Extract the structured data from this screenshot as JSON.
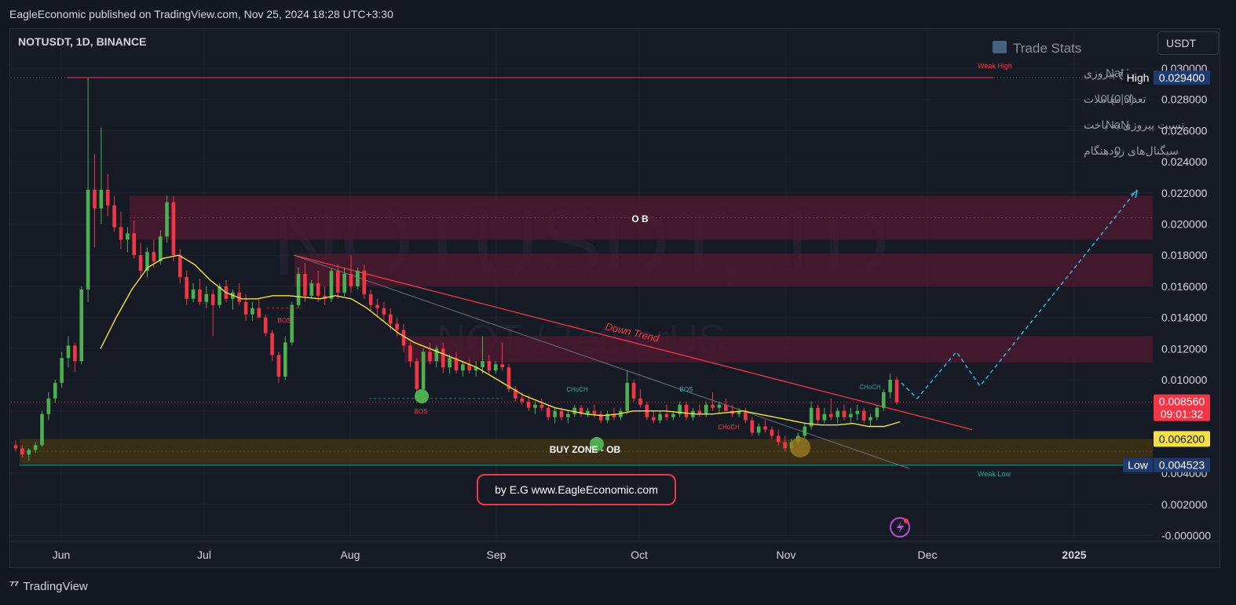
{
  "header": {
    "published": "EagleEconomic published on TradingView.com, Nov 25, 2024 18:28 UTC+3:30",
    "symbol": "NOTUSDT, 1D, BINANCE",
    "currency": "USDT",
    "footer_brand": "TradingView"
  },
  "watermark": {
    "symbol": "NOTUSDT, 1D",
    "name": "NOT / TetherUS"
  },
  "trade_stats": {
    "title": "Trade Stats",
    "rows": [
      {
        "label": "نرخ پیروزی",
        "value": "NaN"
      },
      {
        "label": "تعداد معاملات",
        "value": "0 (0|0)"
      },
      {
        "label": "نسبت پیروزی به باخت",
        "value": "NaN"
      },
      {
        "label": "سیگنال‌های زودهنگام",
        "value": "0"
      }
    ]
  },
  "annotations": {
    "ob": "O B",
    "buy_zone": "BUY ZONE - OB",
    "down_trend": "Down Trend",
    "weak_high": "Weak High",
    "weak_low": "Weak Low",
    "bos": "BOS",
    "choch": "CHoCH",
    "credit": "by E.G www.EagleEconomic.com"
  },
  "colors": {
    "bull": "#26a69a",
    "bear": "#ef5350",
    "bull_candle": "#4caf50",
    "bear_candle": "#f23645",
    "ma": "#f5e04b",
    "zone_red": "#5a1f35",
    "zone_buy": "#4a3a14",
    "projection": "#29b6d8",
    "trendline": "#f23645"
  },
  "chart_data": {
    "type": "candlestick",
    "title": "NOTUSDT, 1D, BINANCE",
    "y_axis": {
      "ticks": [
        "0.030000",
        "0.028000",
        "0.026000",
        "0.024000",
        "0.022000",
        "0.020000",
        "0.018000",
        "0.016000",
        "0.014000",
        "0.012000",
        "0.010000",
        "0.008000",
        "0.006000",
        "0.004000",
        "0.002000",
        "-0.000000"
      ],
      "ylim": [
        -0.0003,
        0.0306
      ]
    },
    "x_axis": {
      "ticks": [
        "Jun",
        "Jul",
        "Aug",
        "Sep",
        "Oct",
        "Nov",
        "Dec",
        "2025"
      ]
    },
    "price_labels": [
      {
        "tag": "High",
        "value": "0.029400"
      },
      {
        "tag": "",
        "value": "0.008560",
        "countdown": "09:01:32"
      },
      {
        "tag": "",
        "value": "0.006200"
      },
      {
        "tag": "Low",
        "value": "0.004523"
      }
    ],
    "levels": {
      "high": 0.0294,
      "low": 0.004523,
      "last": 0.00856,
      "ma_last": 0.0062
    },
    "zones": [
      {
        "name": "OB",
        "from": 0.019,
        "to": 0.0218
      },
      {
        "name": "OB-2",
        "from": 0.016,
        "to": 0.0181
      },
      {
        "name": "OB-3",
        "from": 0.0111,
        "to": 0.0128
      },
      {
        "name": "BUY ZONE - OB",
        "from": 0.0046,
        "to": 0.0062
      }
    ],
    "candles": [
      [
        0.0058,
        0.0061,
        0.0054,
        0.0056
      ],
      [
        0.0056,
        0.0058,
        0.005,
        0.0052
      ],
      [
        0.0052,
        0.0056,
        0.0048,
        0.0055
      ],
      [
        0.0055,
        0.006,
        0.0053,
        0.0058
      ],
      [
        0.0058,
        0.008,
        0.0057,
        0.0078
      ],
      [
        0.0078,
        0.0092,
        0.0074,
        0.0088
      ],
      [
        0.0088,
        0.01,
        0.0085,
        0.0098
      ],
      [
        0.0098,
        0.0118,
        0.0095,
        0.0114
      ],
      [
        0.0114,
        0.0128,
        0.0108,
        0.0122
      ],
      [
        0.0122,
        0.0124,
        0.0105,
        0.0112
      ],
      [
        0.0112,
        0.016,
        0.011,
        0.0158
      ],
      [
        0.0158,
        0.0294,
        0.015,
        0.0222
      ],
      [
        0.0222,
        0.0245,
        0.0185,
        0.021
      ],
      [
        0.021,
        0.0262,
        0.02,
        0.0222
      ],
      [
        0.0222,
        0.0232,
        0.0205,
        0.0212
      ],
      [
        0.0212,
        0.0218,
        0.0195,
        0.0198
      ],
      [
        0.0198,
        0.0208,
        0.0184,
        0.019
      ],
      [
        0.019,
        0.0198,
        0.0182,
        0.0194
      ],
      [
        0.0194,
        0.0202,
        0.0178,
        0.018
      ],
      [
        0.018,
        0.0188,
        0.0165,
        0.017
      ],
      [
        0.017,
        0.0185,
        0.0166,
        0.0182
      ],
      [
        0.0182,
        0.019,
        0.0172,
        0.0176
      ],
      [
        0.0176,
        0.0196,
        0.0174,
        0.0192
      ],
      [
        0.0192,
        0.0218,
        0.0188,
        0.0214
      ],
      [
        0.0214,
        0.0218,
        0.0176,
        0.018
      ],
      [
        0.018,
        0.0184,
        0.0162,
        0.0166
      ],
      [
        0.0166,
        0.017,
        0.0148,
        0.0152
      ],
      [
        0.0152,
        0.0162,
        0.015,
        0.0158
      ],
      [
        0.0158,
        0.0165,
        0.0148,
        0.015
      ],
      [
        0.015,
        0.016,
        0.0146,
        0.0155
      ],
      [
        0.0155,
        0.0158,
        0.0128,
        0.0148
      ],
      [
        0.0148,
        0.0162,
        0.0146,
        0.016
      ],
      [
        0.016,
        0.0164,
        0.015,
        0.0152
      ],
      [
        0.0152,
        0.0158,
        0.0145,
        0.0156
      ],
      [
        0.0156,
        0.0162,
        0.0148,
        0.015
      ],
      [
        0.015,
        0.0155,
        0.0138,
        0.0142
      ],
      [
        0.0142,
        0.015,
        0.0138,
        0.0146
      ],
      [
        0.0146,
        0.0152,
        0.014,
        0.014
      ],
      [
        0.014,
        0.0142,
        0.0128,
        0.013
      ],
      [
        0.013,
        0.0132,
        0.0112,
        0.0116
      ],
      [
        0.0116,
        0.0118,
        0.0098,
        0.0102
      ],
      [
        0.0102,
        0.0128,
        0.01,
        0.0124
      ],
      [
        0.0124,
        0.015,
        0.0122,
        0.0148
      ],
      [
        0.0148,
        0.0172,
        0.0146,
        0.0168
      ],
      [
        0.0168,
        0.0175,
        0.015,
        0.0154
      ],
      [
        0.0154,
        0.0164,
        0.0152,
        0.0162
      ],
      [
        0.0162,
        0.017,
        0.015,
        0.0154
      ],
      [
        0.0154,
        0.016,
        0.0148,
        0.0152
      ],
      [
        0.0152,
        0.0172,
        0.015,
        0.017
      ],
      [
        0.017,
        0.0174,
        0.0152,
        0.0156
      ],
      [
        0.0156,
        0.0172,
        0.0154,
        0.0168
      ],
      [
        0.0168,
        0.018,
        0.0156,
        0.016
      ],
      [
        0.016,
        0.0172,
        0.0158,
        0.017
      ],
      [
        0.017,
        0.0174,
        0.0152,
        0.0155
      ],
      [
        0.0155,
        0.0158,
        0.0144,
        0.0148
      ],
      [
        0.0148,
        0.0152,
        0.014,
        0.0146
      ],
      [
        0.0146,
        0.015,
        0.0138,
        0.0142
      ],
      [
        0.0142,
        0.0146,
        0.0132,
        0.0136
      ],
      [
        0.0136,
        0.014,
        0.0128,
        0.0132
      ],
      [
        0.0132,
        0.0136,
        0.0118,
        0.0122
      ],
      [
        0.0122,
        0.0124,
        0.0108,
        0.0112
      ],
      [
        0.0112,
        0.0114,
        0.009,
        0.0094
      ],
      [
        0.0094,
        0.012,
        0.0092,
        0.0118
      ],
      [
        0.0118,
        0.0124,
        0.011,
        0.0112
      ],
      [
        0.0112,
        0.0122,
        0.0108,
        0.012
      ],
      [
        0.012,
        0.0124,
        0.0104,
        0.0108
      ],
      [
        0.0108,
        0.0116,
        0.0104,
        0.0114
      ],
      [
        0.0114,
        0.0118,
        0.0104,
        0.0106
      ],
      [
        0.0106,
        0.0112,
        0.0102,
        0.011
      ],
      [
        0.011,
        0.0114,
        0.0104,
        0.0106
      ],
      [
        0.0106,
        0.0112,
        0.0102,
        0.0108
      ],
      [
        0.0108,
        0.0128,
        0.0104,
        0.0112
      ],
      [
        0.0112,
        0.0116,
        0.0104,
        0.0106
      ],
      [
        0.0106,
        0.0112,
        0.0104,
        0.011
      ],
      [
        0.011,
        0.0124,
        0.0106,
        0.0108
      ],
      [
        0.0108,
        0.011,
        0.0092,
        0.0094
      ],
      [
        0.0094,
        0.0096,
        0.0086,
        0.0088
      ],
      [
        0.0088,
        0.0092,
        0.0084,
        0.0086
      ],
      [
        0.0086,
        0.009,
        0.008,
        0.0082
      ],
      [
        0.0082,
        0.0086,
        0.0078,
        0.0084
      ],
      [
        0.0084,
        0.0088,
        0.008,
        0.0082
      ],
      [
        0.0082,
        0.0084,
        0.0074,
        0.0076
      ],
      [
        0.0076,
        0.0082,
        0.0072,
        0.008
      ],
      [
        0.008,
        0.0082,
        0.0074,
        0.0076
      ],
      [
        0.0076,
        0.008,
        0.0072,
        0.0078
      ],
      [
        0.0078,
        0.0084,
        0.0076,
        0.0082
      ],
      [
        0.0082,
        0.0084,
        0.0076,
        0.0078
      ],
      [
        0.0078,
        0.0082,
        0.0076,
        0.008
      ],
      [
        0.008,
        0.0084,
        0.0076,
        0.0078
      ],
      [
        0.0078,
        0.008,
        0.0072,
        0.0074
      ],
      [
        0.0074,
        0.008,
        0.0072,
        0.0078
      ],
      [
        0.0078,
        0.0082,
        0.0074,
        0.0076
      ],
      [
        0.0076,
        0.0082,
        0.0074,
        0.008
      ],
      [
        0.008,
        0.0106,
        0.0078,
        0.0098
      ],
      [
        0.0098,
        0.01,
        0.0086,
        0.0088
      ],
      [
        0.0088,
        0.0094,
        0.0082,
        0.0084
      ],
      [
        0.0084,
        0.0086,
        0.0074,
        0.0076
      ],
      [
        0.0076,
        0.008,
        0.0072,
        0.0074
      ],
      [
        0.0074,
        0.008,
        0.0072,
        0.0078
      ],
      [
        0.0078,
        0.0084,
        0.0074,
        0.0076
      ],
      [
        0.0076,
        0.008,
        0.0074,
        0.0078
      ],
      [
        0.0078,
        0.0086,
        0.0076,
        0.0084
      ],
      [
        0.0084,
        0.0086,
        0.0074,
        0.0076
      ],
      [
        0.0076,
        0.0082,
        0.0074,
        0.008
      ],
      [
        0.008,
        0.0084,
        0.0076,
        0.0078
      ],
      [
        0.0078,
        0.0086,
        0.0076,
        0.0084
      ],
      [
        0.0084,
        0.0092,
        0.008,
        0.0082
      ],
      [
        0.0082,
        0.0086,
        0.0078,
        0.0084
      ],
      [
        0.0084,
        0.0088,
        0.008,
        0.008
      ],
      [
        0.008,
        0.0084,
        0.0076,
        0.0078
      ],
      [
        0.0078,
        0.0082,
        0.0076,
        0.008
      ],
      [
        0.008,
        0.0082,
        0.0072,
        0.0074
      ],
      [
        0.0074,
        0.0076,
        0.0064,
        0.0066
      ],
      [
        0.0066,
        0.0072,
        0.0064,
        0.007
      ],
      [
        0.007,
        0.0074,
        0.0066,
        0.0068
      ],
      [
        0.0068,
        0.007,
        0.0062,
        0.0064
      ],
      [
        0.0064,
        0.0068,
        0.0058,
        0.006
      ],
      [
        0.006,
        0.0064,
        0.0054,
        0.0056
      ],
      [
        0.0056,
        0.0062,
        0.0054,
        0.006
      ],
      [
        0.006,
        0.0066,
        0.0058,
        0.0064
      ],
      [
        0.0064,
        0.0072,
        0.0062,
        0.007
      ],
      [
        0.007,
        0.0086,
        0.0068,
        0.0082
      ],
      [
        0.0082,
        0.0084,
        0.0072,
        0.0074
      ],
      [
        0.0074,
        0.0082,
        0.0072,
        0.0078
      ],
      [
        0.0078,
        0.0088,
        0.0074,
        0.0076
      ],
      [
        0.0076,
        0.0082,
        0.0072,
        0.008
      ],
      [
        0.008,
        0.0084,
        0.0074,
        0.0076
      ],
      [
        0.0076,
        0.0082,
        0.0072,
        0.0078
      ],
      [
        0.0078,
        0.0084,
        0.0074,
        0.008
      ],
      [
        0.008,
        0.0082,
        0.0072,
        0.0074
      ],
      [
        0.0074,
        0.0078,
        0.007,
        0.0076
      ],
      [
        0.0076,
        0.0084,
        0.0074,
        0.0082
      ],
      [
        0.0082,
        0.0094,
        0.008,
        0.0092
      ],
      [
        0.0092,
        0.0104,
        0.0088,
        0.01
      ],
      [
        0.01,
        0.0102,
        0.0084,
        0.00856
      ]
    ],
    "ma_line": [
      0.012,
      0.014,
      0.0158,
      0.0172,
      0.0178,
      0.018,
      0.0174,
      0.0164,
      0.0156,
      0.0152,
      0.0152,
      0.0154,
      0.0154,
      0.0153,
      0.0152,
      0.0154,
      0.0152,
      0.0146,
      0.0138,
      0.013,
      0.0124,
      0.012,
      0.0116,
      0.0112,
      0.0108,
      0.0102,
      0.0096,
      0.009,
      0.0086,
      0.0082,
      0.008,
      0.0078,
      0.0077,
      0.0078,
      0.008,
      0.008,
      0.008,
      0.0079,
      0.0078,
      0.0078,
      0.0079,
      0.008,
      0.0078,
      0.0076,
      0.0074,
      0.0072,
      0.0071,
      0.0071,
      0.0072,
      0.007,
      0.007,
      0.0073
    ],
    "projection_path": [
      [
        0.0098,
        0
      ],
      [
        0.0088,
        1
      ],
      [
        0.0118,
        2
      ],
      [
        0.0096,
        3
      ],
      [
        0.0222,
        4
      ]
    ]
  }
}
